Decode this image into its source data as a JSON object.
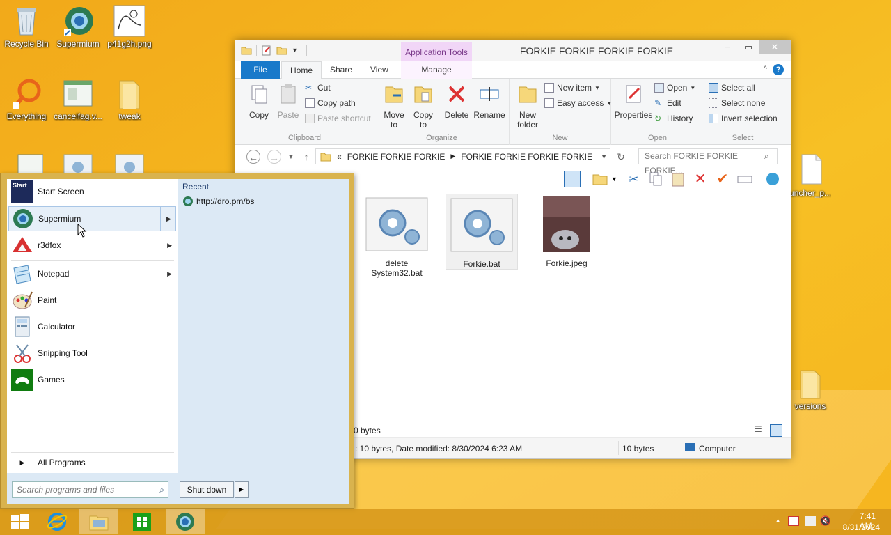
{
  "desktop": {
    "icons": [
      {
        "label": "Recycle Bin",
        "icon": "recycle-bin-icon"
      },
      {
        "label": "Supermium",
        "icon": "supermium-icon"
      },
      {
        "label": "p41g2h.png",
        "icon": "image-file-icon"
      },
      {
        "label": "Everything",
        "icon": "everything-search-icon"
      },
      {
        "label": "cancelfag.v...",
        "icon": "window-file-icon"
      },
      {
        "label": "tweak",
        "icon": "folder-icon"
      },
      {
        "label": "uncher_p...",
        "icon": "blank-file-icon"
      },
      {
        "label": "versions",
        "icon": "folder-icon"
      }
    ]
  },
  "explorer": {
    "title": "FORKIE FORKIE FORKIE FORKIE",
    "context_tab": "Application Tools",
    "tabs": [
      "File",
      "Home",
      "Share",
      "View",
      "Manage"
    ],
    "ribbon": {
      "clipboard": {
        "label": "Clipboard",
        "copy": "Copy",
        "paste": "Paste",
        "cut": "Cut",
        "copy_path": "Copy path",
        "paste_shortcut": "Paste shortcut"
      },
      "organize": {
        "label": "Organize",
        "move_to": "Move to",
        "copy_to": "Copy to",
        "delete": "Delete",
        "rename": "Rename"
      },
      "new": {
        "label": "New",
        "new_folder": "New folder",
        "new_item": "New item",
        "easy_access": "Easy access"
      },
      "open": {
        "label": "Open",
        "properties": "Properties",
        "open": "Open",
        "edit": "Edit",
        "history": "History"
      },
      "select": {
        "label": "Select",
        "select_all": "Select all",
        "select_none": "Select none",
        "invert": "Invert selection"
      }
    },
    "address": {
      "path_prefix": "«",
      "segments": [
        "FORKIE FORKIE FORKIE",
        "FORKIE FORKIE FORKIE FORKIE"
      ],
      "search_placeholder": "Search FORKIE FORKIE FORKIE..."
    },
    "files": [
      {
        "name": "delete System32.bat",
        "icon": "batch-file-icon",
        "selected": false
      },
      {
        "name": "Forkie.bat",
        "icon": "batch-file-icon",
        "selected": true
      },
      {
        "name": "Forkie.jpeg",
        "icon": "image-thumbnail-icon",
        "selected": false
      }
    ],
    "status": {
      "count": "0 bytes",
      "details": ": 10 bytes, Date modified: 8/30/2024 6:23 AM",
      "size": "10 bytes",
      "location": "Computer"
    }
  },
  "start_menu": {
    "items": [
      {
        "label": "Start Screen",
        "icon": "start-screen-icon",
        "submenu": false
      },
      {
        "label": "Supermium",
        "icon": "supermium-icon",
        "submenu": true,
        "highlighted": true
      },
      {
        "label": "r3dfox",
        "icon": "r3dfox-icon",
        "submenu": true
      },
      {
        "label": "Notepad",
        "icon": "notepad-icon",
        "submenu": true
      },
      {
        "label": "Paint",
        "icon": "paint-icon",
        "submenu": false
      },
      {
        "label": "Calculator",
        "icon": "calculator-icon",
        "submenu": false
      },
      {
        "label": "Snipping Tool",
        "icon": "snipping-tool-icon",
        "submenu": false
      },
      {
        "label": "Games",
        "icon": "games-icon",
        "submenu": false
      }
    ],
    "all_programs": "All Programs",
    "recent_header": "Recent",
    "recent_items": [
      "http://dro.pm/bs"
    ],
    "search_placeholder": "Search programs and files",
    "shutdown_label": "Shut down",
    "start_label": "Start"
  },
  "taskbar": {
    "apps": [
      "start-button-icon",
      "internet-explorer-icon",
      "file-explorer-icon",
      "store-icon",
      "supermium-icon"
    ],
    "time": "7:41 AM",
    "date": "8/31/2024"
  },
  "colors": {
    "desktop": "#f4b41e",
    "file_tab": "#1979ca",
    "app_tools": "#f1d6f7",
    "start_frame": "#d9b34e",
    "start_panel": "#dce9f5"
  }
}
